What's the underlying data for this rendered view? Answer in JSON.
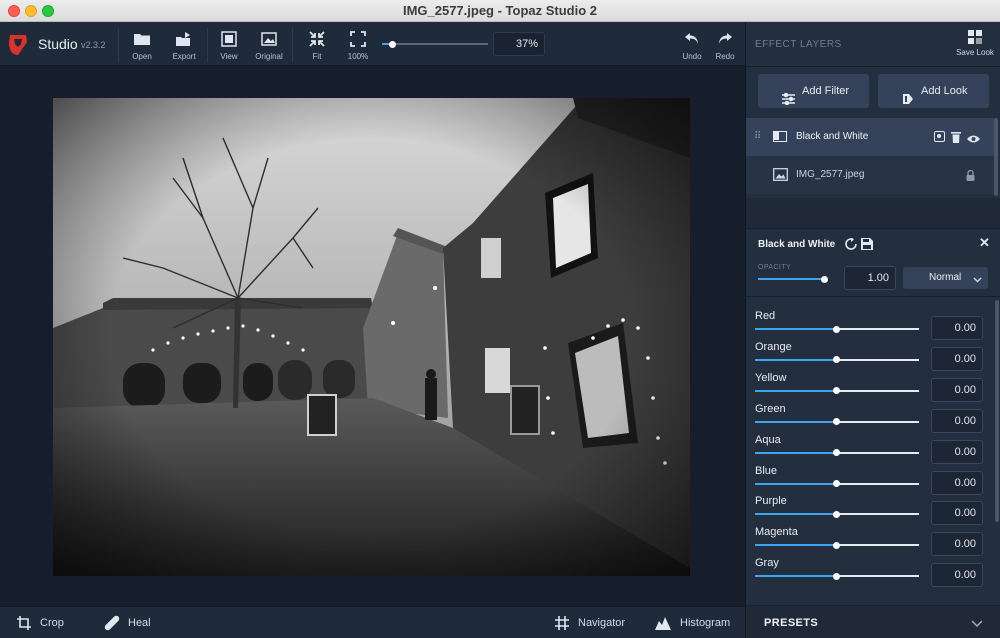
{
  "window": {
    "title": "IMG_2577.jpeg - Topaz Studio 2"
  },
  "brand": {
    "name": "Studio",
    "version": "v2.3.2"
  },
  "toolbar": {
    "open": "Open",
    "export": "Export",
    "view": "View",
    "original": "Original",
    "fit": "Fit",
    "hundred": "100%",
    "zoom": "37%",
    "zoom_fraction": 0.1,
    "undo": "Undo",
    "redo": "Redo"
  },
  "panel": {
    "header": "EFFECT LAYERS",
    "save_look": "Save Look",
    "add_filter": "Add Filter",
    "add_look": "Add Look",
    "layers": [
      {
        "name": "Black and White"
      },
      {
        "name": "IMG_2577.jpeg"
      }
    ],
    "filter": {
      "title": "Black and White",
      "opacity_label": "OPACITY",
      "opacity_value": "1.00",
      "opacity_fraction": 1.0,
      "blend_mode": "Normal"
    },
    "adjustments": [
      {
        "label": "Red",
        "value": "0.00"
      },
      {
        "label": "Orange",
        "value": "0.00"
      },
      {
        "label": "Yellow",
        "value": "0.00"
      },
      {
        "label": "Green",
        "value": "0.00"
      },
      {
        "label": "Aqua",
        "value": "0.00"
      },
      {
        "label": "Blue",
        "value": "0.00"
      },
      {
        "label": "Purple",
        "value": "0.00"
      },
      {
        "label": "Magenta",
        "value": "0.00"
      },
      {
        "label": "Gray",
        "value": "0.00"
      }
    ],
    "presets": "PRESETS"
  },
  "bottom": {
    "crop": "Crop",
    "heal": "Heal",
    "navigator": "Navigator",
    "histogram": "Histogram"
  },
  "colors": {
    "accent": "#3ea3f0",
    "brand_red": "#d8342c"
  }
}
